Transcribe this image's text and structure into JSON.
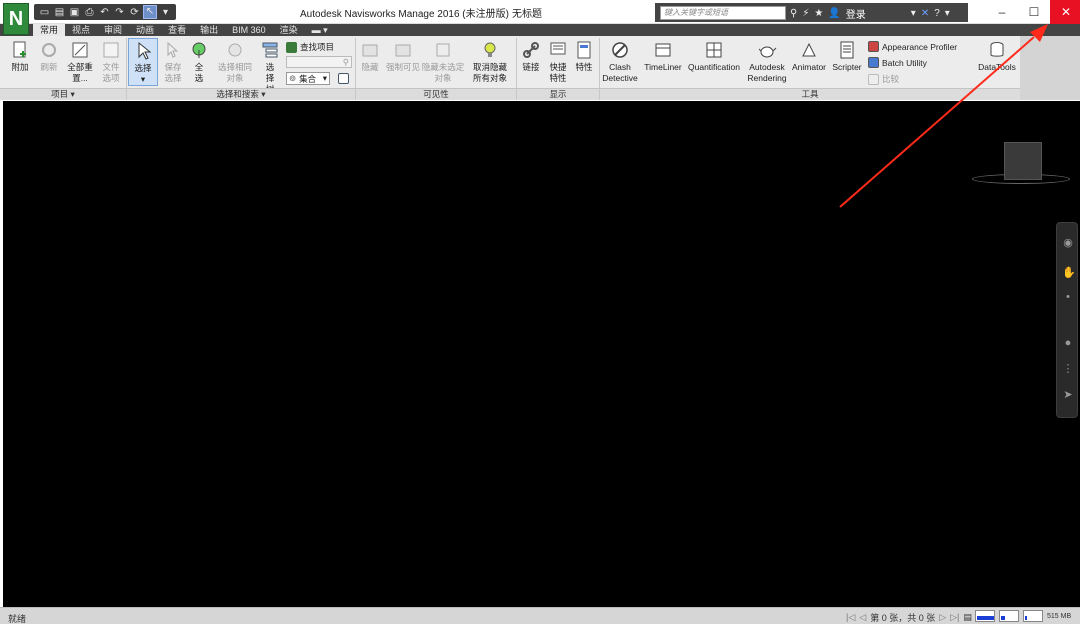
{
  "app": {
    "logo_letter": "N",
    "title": "Autodesk Navisworks Manage 2016 (未注册版)",
    "document": "无标题",
    "search_placeholder": "键入关键字或短语",
    "login_label": "登录",
    "help_label": "?"
  },
  "tabs": [
    {
      "label": "常用",
      "active": true
    },
    {
      "label": "视点"
    },
    {
      "label": "审阅"
    },
    {
      "label": "动画"
    },
    {
      "label": "查看"
    },
    {
      "label": "输出"
    },
    {
      "label": "BIM 360"
    },
    {
      "label": "渲染"
    }
  ],
  "ribbon": {
    "project": {
      "append_label": "附加",
      "refresh_label": "刷新",
      "reset_all_label": "全部重置...",
      "file_options_label": "文件选项",
      "footer": "项目 ▾"
    },
    "select_search": {
      "select_label": "选择",
      "save_selection_label": "保存选择",
      "select_all_label": "全选",
      "select_same_label": "选择相同对象",
      "selection_tree_label": "选择树",
      "find_items_label": "查找项目",
      "sets_label": "集合",
      "footer": "选择和搜索 ▾"
    },
    "visibility": {
      "hide_label": "隐藏",
      "require_label": "强制可见",
      "hide_unselected_label": "隐藏未选定对象",
      "unhide_all_label": "取消隐藏所有对象",
      "footer": "可见性"
    },
    "display": {
      "links_label": "链接",
      "quick_props_label": "快捷特性",
      "properties_label": "特性",
      "footer": "显示"
    },
    "tools": {
      "clash_label": "Clash Detective",
      "timeliner_label": "TimeLiner",
      "quantification_label": "Quantification",
      "rendering_label": "Autodesk Rendering",
      "animator_label": "Animator",
      "scripter_label": "Scripter",
      "appearance_profiler_label": "Appearance Profiler",
      "batch_utility_label": "Batch Utility",
      "compare_label": "比较",
      "datatools_label": "DataTools",
      "footer": "工具"
    }
  },
  "status": {
    "ready": "就绪",
    "sheet_count": "第 0 张，共 0 张",
    "memory": "515 MB"
  },
  "colors": {
    "close_button": "#e81123",
    "annotation_arrow": "#ff2a1a",
    "active_tab": "#e8e8e8",
    "viewport": "#000000"
  }
}
